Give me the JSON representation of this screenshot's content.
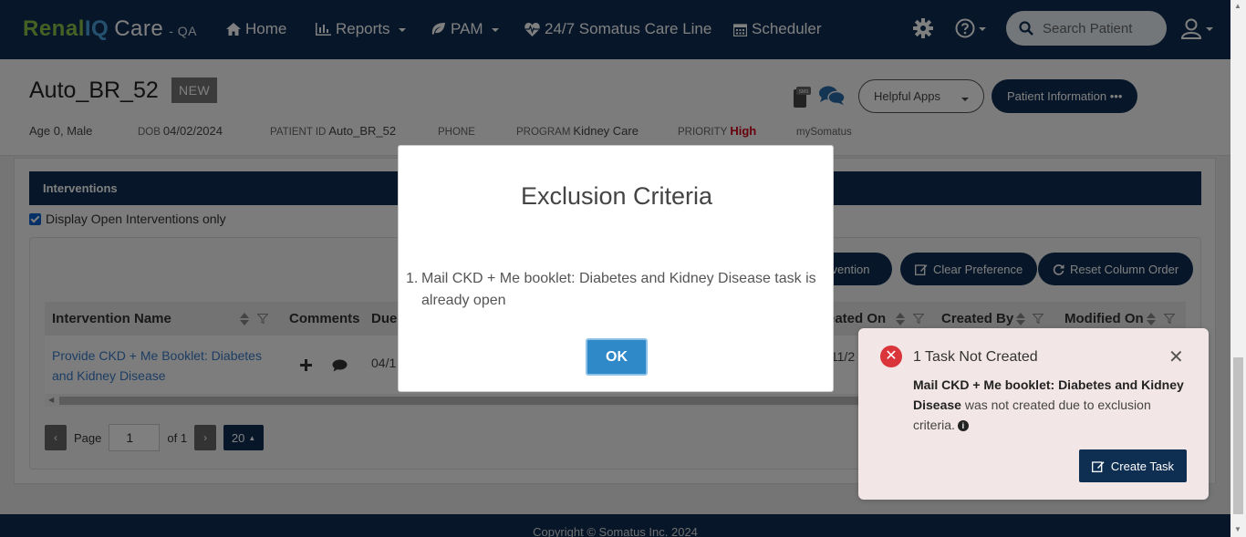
{
  "nav": {
    "brand_renal": "Renal",
    "brand_iq": "IQ",
    "brand_care": "Care",
    "env": "- QA",
    "home": "Home",
    "reports": "Reports",
    "pam": "PAM",
    "care_line": "24/7 Somatus Care Line",
    "scheduler": "Scheduler",
    "search_placeholder": "Search Patient"
  },
  "patient": {
    "name": "Auto_BR_52",
    "badge": "NEW",
    "age_sex": "Age 0, Male",
    "dob_label": "DOB",
    "dob": "04/02/2024",
    "id_label": "PATIENT ID",
    "id": "Auto_BR_52",
    "phone_label": "PHONE",
    "program_label": "PROGRAM",
    "program": "Kidney Care",
    "priority_label": "PRIORITY",
    "priority": "High",
    "mysomatus": "mySomatus",
    "helpful_apps": "Helpful Apps",
    "patient_info": "Patient Information •••"
  },
  "interventions": {
    "title": "Interventions",
    "display_open_only": "Display Open Interventions only",
    "btn_intervention": "ervention",
    "btn_clear": "Clear Preference",
    "btn_reset": "Reset Column Order",
    "columns": [
      "Intervention Name",
      "Comments",
      "Due",
      "eated On",
      "Created By",
      "Modified On"
    ],
    "row": {
      "name": "Provide CKD + Me Booklet: Diabetes and Kidney Disease",
      "due": "04/1",
      "created_on_1": "/11/2",
      "created_on_2": "1"
    },
    "pager": {
      "page_label": "Page",
      "page": "1",
      "of": "of 1",
      "size": "20"
    }
  },
  "footer": "Copyright © Somatus Inc. 2024",
  "modal": {
    "title": "Exclusion Criteria",
    "item_num": "1.",
    "item_text": "Mail CKD + Me booklet: Diabetes and Kidney Disease task is already open",
    "ok": "OK"
  },
  "toast": {
    "title": "1 Task Not Created",
    "bold_text": "Mail CKD + Me booklet: Diabetes and Kidney Disease",
    "rest_text": "was not created due to exclusion criteria.",
    "button": "Create Task"
  }
}
